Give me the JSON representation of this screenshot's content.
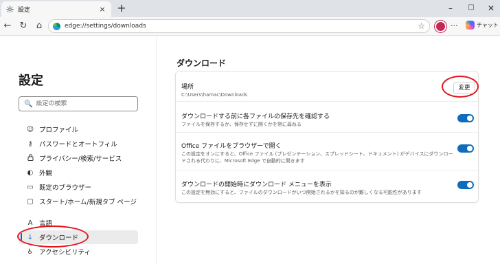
{
  "tab": {
    "title": "設定",
    "close": "×",
    "icon": "gear-icon"
  },
  "newtab": "+",
  "window": {
    "minimize": "–",
    "maximize": "☐",
    "close": "✕"
  },
  "nav": {
    "back": "←",
    "refresh": "↻",
    "home": "⌂"
  },
  "address": {
    "url": "edge://settings/downloads",
    "favorite": "☆"
  },
  "toolbar": {
    "more": "···",
    "copilot_label": "チャット"
  },
  "sidebar": {
    "title": "設定",
    "search_placeholder": "設定の検索",
    "search_icon": "🔍",
    "items": [
      {
        "label": "プロファイル",
        "icon": "profile-icon",
        "glyph": "☺"
      },
      {
        "label": "パスワードとオートフィル",
        "icon": "key-icon",
        "glyph": "⚷"
      },
      {
        "label": "プライバシー/検索/サービス",
        "icon": "lock-icon",
        "glyph": "🔒"
      },
      {
        "label": "外観",
        "icon": "appearance-icon",
        "glyph": "◐"
      },
      {
        "label": "既定のブラウザー",
        "icon": "browser-icon",
        "glyph": "▭"
      },
      {
        "label": "スタート/ホーム/新規タブ ページ",
        "icon": "home-icon",
        "glyph": "▢"
      },
      {
        "label": "言語",
        "icon": "language-icon",
        "glyph": "A"
      },
      {
        "label": "ダウンロード",
        "icon": "download-icon",
        "glyph": "↓",
        "active": true
      },
      {
        "label": "アクセシビリティ",
        "icon": "accessibility-icon",
        "glyph": "♿"
      }
    ]
  },
  "main": {
    "title": "ダウンロード",
    "location": {
      "label": "場所",
      "path": "C:\\Users\\hamac\\Downloads",
      "button": "変更"
    },
    "settings": [
      {
        "title": "ダウンロードする前に各ファイルの保存先を確認する",
        "desc": "ファイルを保存するか、保存せずに開くかを常に尋ねる",
        "on": true
      },
      {
        "title": "Office ファイルをブラウザーで開く",
        "desc": "この設定をオンにすると、Office ファイル (プレゼンテーション、スプレッドシート、ドキュメント) がデバイスにダウンロードされる代わりに、Microsoft Edge で自動的に開きます",
        "on": true
      },
      {
        "title": "ダウンロードの開始時にダウンロード メニューを表示",
        "desc": "この設定を無効にすると、ファイルのダウンロードがいつ開始されるかを知るのが難しくなる可能性があります",
        "on": true
      }
    ]
  },
  "colors": {
    "accent": "#0f6cbd",
    "annotation": "#e3141c"
  }
}
